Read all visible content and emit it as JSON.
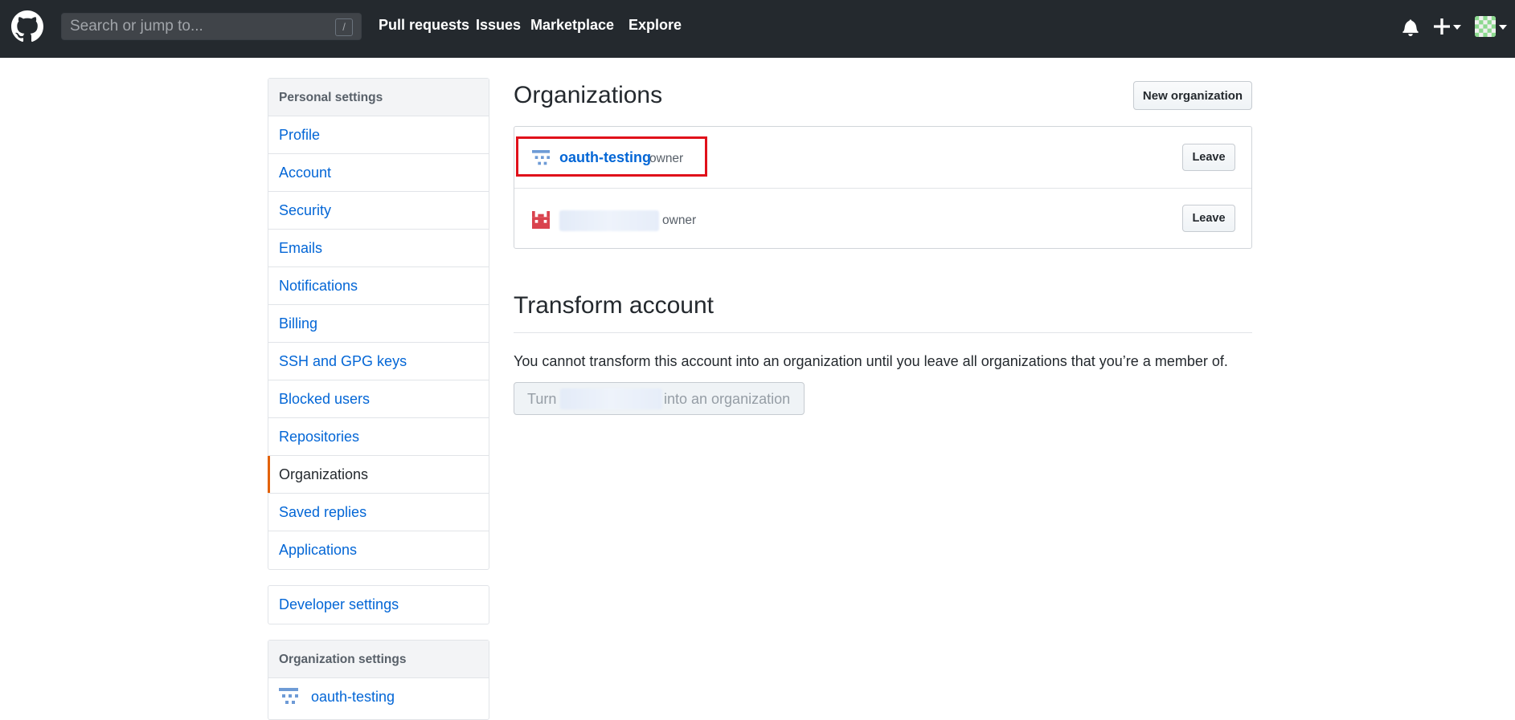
{
  "header": {
    "search_placeholder": "Search or jump to...",
    "search_shortcut": "/",
    "nav": [
      "Pull requests",
      "Issues",
      "Marketplace",
      "Explore"
    ]
  },
  "sidebar": {
    "personal_heading": "Personal settings",
    "items": [
      {
        "label": "Profile"
      },
      {
        "label": "Account"
      },
      {
        "label": "Security"
      },
      {
        "label": "Emails"
      },
      {
        "label": "Notifications"
      },
      {
        "label": "Billing"
      },
      {
        "label": "SSH and GPG keys"
      },
      {
        "label": "Blocked users"
      },
      {
        "label": "Repositories"
      },
      {
        "label": "Organizations",
        "selected": true
      },
      {
        "label": "Saved replies"
      },
      {
        "label": "Applications"
      }
    ],
    "developer_settings": "Developer settings",
    "org_heading": "Organization settings",
    "org_item": "oauth-testing"
  },
  "main": {
    "title": "Organizations",
    "new_org_button": "New organization",
    "orgs": [
      {
        "name": "oauth-testing",
        "role": "owner",
        "leave": "Leave"
      },
      {
        "name": "",
        "role": "owner",
        "leave": "Leave"
      }
    ],
    "transform_title": "Transform account",
    "transform_note": "You cannot transform this account into an organization until you leave all organizations that you’re a member of.",
    "transform_button_prefix": "Turn",
    "transform_button_suffix": "into an organization"
  },
  "colors": {
    "header_bg": "#24292e",
    "link": "#0366d6",
    "selected_indicator": "#e36209",
    "highlight": "#e0101a"
  },
  "icons": [
    "github-logo-icon",
    "bell-icon",
    "plus-icon",
    "chevron-down-icon",
    "avatar",
    "org-avatar-icon"
  ]
}
